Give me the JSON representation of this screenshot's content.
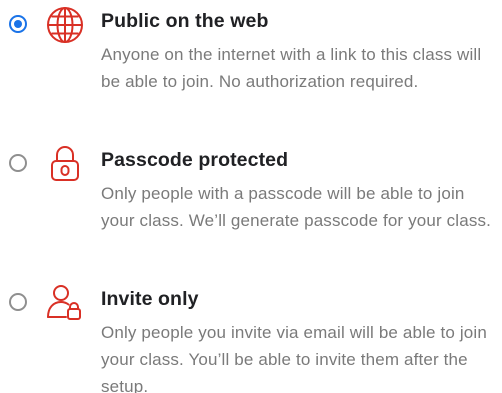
{
  "colors": {
    "accent": "#1a73e8",
    "icon_red": "#d93025",
    "title_text": "#202124",
    "description_text": "#7a7a7a",
    "radio_border": "#8f8f8f"
  },
  "options": [
    {
      "title": "Public on the web",
      "description": "Anyone on the internet with a link to this class will be able to join. No authorization required.",
      "icon": "globe-icon",
      "selected": true
    },
    {
      "title": "Passcode protected",
      "description": "Only people with a passcode will be able to join your class. We’ll generate passcode for your class.",
      "icon": "padlock-icon",
      "selected": false
    },
    {
      "title": "Invite only",
      "description": "Only people you invite via email will be able to join your class. You’ll be able to invite them after the setup.",
      "icon": "user-lock-icon",
      "selected": false
    }
  ]
}
